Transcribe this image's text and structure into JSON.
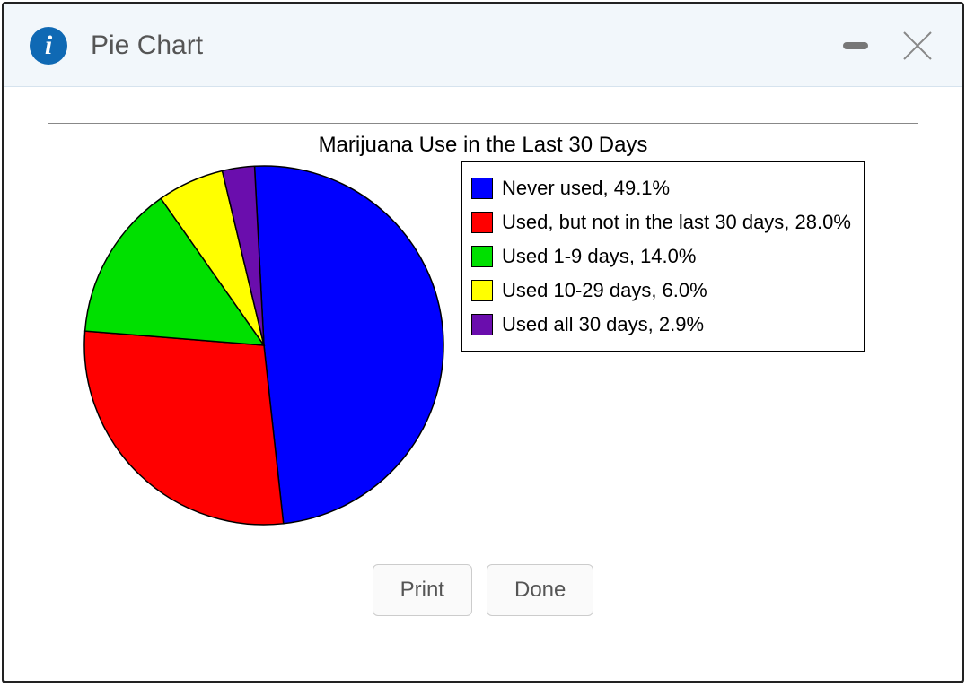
{
  "titlebar": {
    "title": "Pie Chart"
  },
  "buttons": {
    "print": "Print",
    "done": "Done"
  },
  "chart_data": {
    "type": "pie",
    "title": "Marijuana Use in the Last 30 Days",
    "start_angle_deg": -93,
    "series": [
      {
        "name": "Never used",
        "value": 49.1,
        "color": "#0000ff",
        "legend": "Never used, 49.1%"
      },
      {
        "name": "Used, but not in the last 30 days",
        "value": 28.0,
        "color": "#ff0000",
        "legend": "Used, but not in the last 30 days, 28.0%"
      },
      {
        "name": "Used 1-9 days",
        "value": 14.0,
        "color": "#00e000",
        "legend": "Used 1-9 days, 14.0%"
      },
      {
        "name": "Used 10-29 days",
        "value": 6.0,
        "color": "#ffff00",
        "legend": "Used 10-29 days, 6.0%"
      },
      {
        "name": "Used all 30 days",
        "value": 2.9,
        "color": "#6a0dad",
        "legend": "Used all 30 days, 2.9%"
      }
    ]
  }
}
